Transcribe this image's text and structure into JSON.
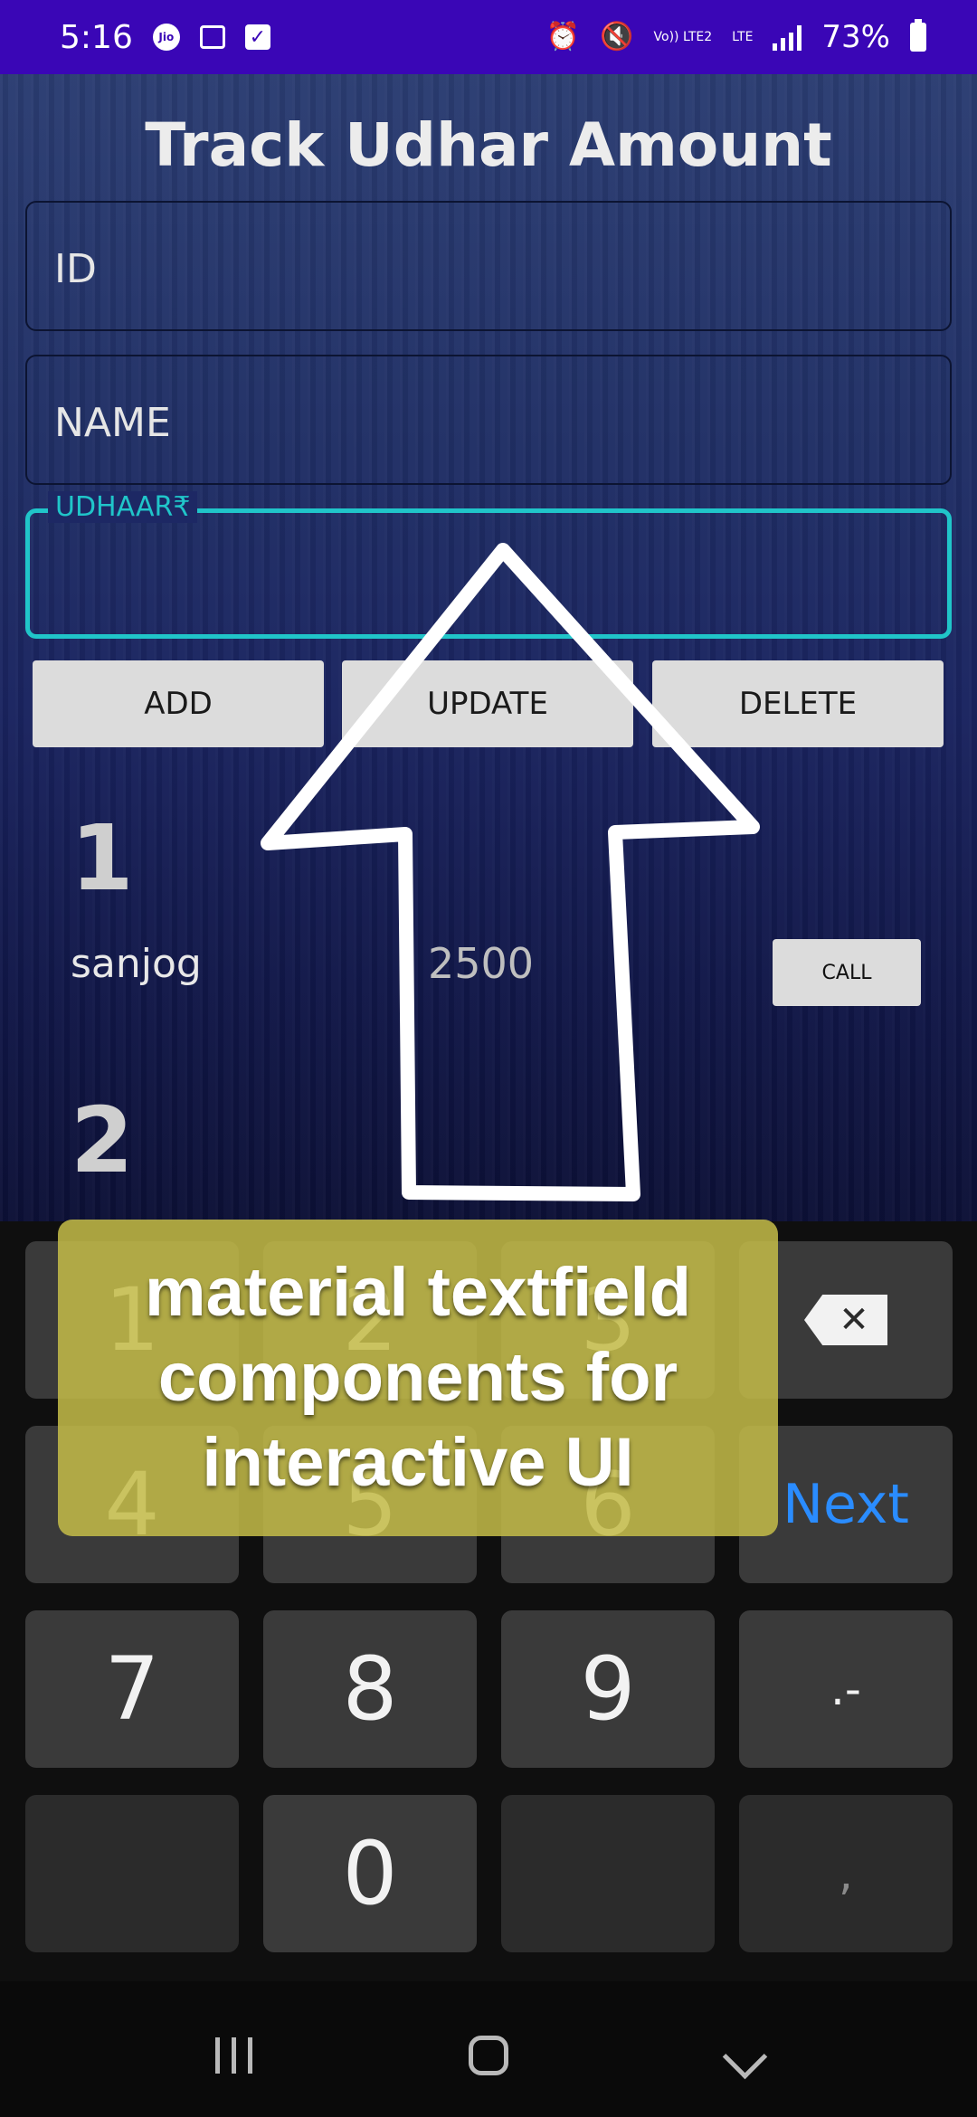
{
  "status_bar": {
    "time": "5:16",
    "battery_percent": "73%",
    "network_label_1": "Vo)) LTE2",
    "network_label_2": "LTE"
  },
  "app": {
    "title": "Track Udhar Amount",
    "fields": {
      "id_placeholder": "ID",
      "name_placeholder": "NAME",
      "udhaar_label": "UDHAAR₹"
    },
    "buttons": {
      "add": "ADD",
      "update": "UPDATE",
      "delete": "DELETE"
    },
    "entries": [
      {
        "id": "1",
        "name": "sanjog",
        "amount": "2500",
        "call_label": "CALL"
      },
      {
        "id": "2"
      }
    ]
  },
  "keyboard": {
    "keys": [
      "1",
      "2",
      "3",
      "4",
      "5",
      "6",
      "7",
      "8",
      "9",
      ".-",
      "0",
      ","
    ],
    "next_label": "Next",
    "backspace_icon": "backspace-icon"
  },
  "overlay_caption": "material textfield components for interactive UI",
  "colors": {
    "status_bar": "#3a06b6",
    "accent_teal": "#20c5c9",
    "next_blue": "#2a8cff"
  }
}
